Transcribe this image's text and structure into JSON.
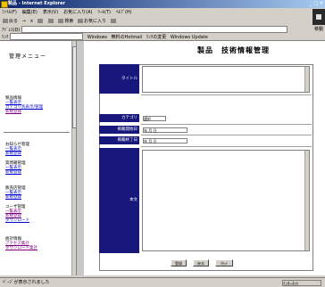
{
  "window": {
    "title": "製品 - Internet Explorer",
    "right_text": "_ □ ×"
  },
  "menu": [
    "ﾌｧｲﾙ(F)",
    "編集(E)",
    "表示(V)",
    "お気に入り(A)",
    "ﾂｰﾙ(T)",
    "ﾍﾙﾌﾟ(H)"
  ],
  "toolbar": {
    "back": "戻る",
    "forward": "→",
    "stop": "×",
    "refresh": "更新",
    "home": "ﾎｰﾑ",
    "search": "検索",
    "favorites": "お気に入り",
    "history": "履歴"
  },
  "address": {
    "label": "ｱﾄﾞﾚｽ(D)",
    "value": "",
    "go": "移動"
  },
  "links": {
    "label": "ﾘﾝｸ",
    "items": [
      "Windows",
      "無料のHotmail",
      "ﾘﾝｸの変更",
      "Windows Update"
    ]
  },
  "left_menu": {
    "title": "管理メニュー",
    "groups": [
      {
        "header": "製品情報",
        "links": [
          "一覧表示",
          "カテゴリ別表示/管理",
          "新規登録"
        ]
      },
      {
        "header": "お知らせ管理",
        "links": [
          "一覧表示",
          "新規登録"
        ]
      },
      {
        "header": "質問箱管理",
        "links": [
          "一覧表示",
          "新規登録"
        ]
      },
      {
        "header": "販売店管理",
        "links": [
          "一覧表示",
          "新規登録"
        ]
      },
      {
        "header": "ユーザ管理",
        "links": [
          "一覧表示",
          "新規登録",
          "ダウンロード"
        ]
      },
      {
        "header": "統計情報",
        "links": [
          "アクセス集計",
          "ダウンロード集計"
        ]
      }
    ]
  },
  "page": {
    "title": "製品　技術情報管理"
  },
  "form": {
    "fields": [
      {
        "label": "タイトル"
      },
      {
        "label": "カテゴリ",
        "value": "選択"
      },
      {
        "label": "掲載開始日",
        "value": "年 月 日"
      },
      {
        "label": "掲載終了日",
        "value": "年 月 日"
      },
      {
        "label": "本文"
      }
    ],
    "buttons": [
      "登録",
      "戻る",
      "ﾘｾｯﾄ"
    ]
  },
  "status": {
    "text": "ﾍﾟｰｼﾞが表示されました",
    "zone": "ｲﾝﾀｰﾈｯﾄ"
  }
}
